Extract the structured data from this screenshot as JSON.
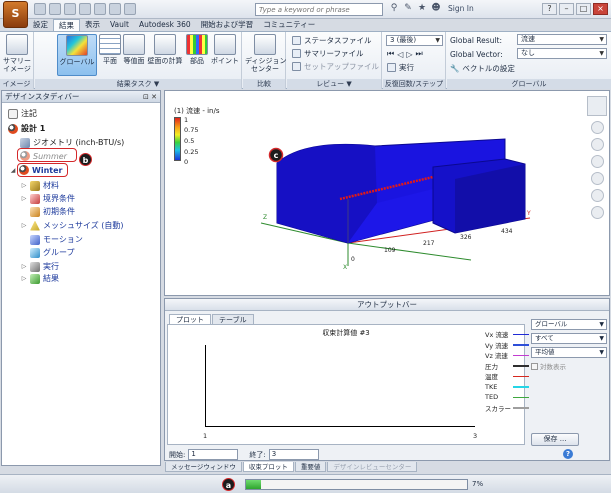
{
  "titlebar": {
    "search_placeholder": "Type a keyword or phrase",
    "sign_in": "Sign In",
    "app_letter": "S"
  },
  "ribbon_tabs": [
    "設定",
    "結果",
    "表示",
    "Vault",
    "Autodesk 360",
    "開始および学習",
    "コミュニティー"
  ],
  "ribbon": {
    "image_panel": {
      "title": "イメージ",
      "summary_image": "サマリー\nイメージ"
    },
    "results_task_panel": {
      "title": "結果タスク ▼",
      "buttons": [
        "グローバル",
        "平面",
        "等值面",
        "壁面の計算",
        "部品",
        "ポイント"
      ]
    },
    "compare_panel": {
      "title": "比較",
      "button": "ディシジョン\nセンター"
    },
    "review_panel": {
      "title": "レビュー ▼",
      "status_file": "ステータスファイル",
      "summary_file": "サマリーファイル",
      "setup_file": "セットアップファイル"
    },
    "iteration_panel": {
      "title": "反復回数/ステップ",
      "combo": "3 (最後)",
      "run": "実行"
    },
    "global_panel": {
      "title": "グローバル",
      "global_result_label": "Global Result:",
      "global_result_value": "流速",
      "global_vector_label": "Global Vector:",
      "global_vector_value": "なし",
      "vector_settings": "ベクトルの設定"
    }
  },
  "design_study_bar": {
    "title": "デザインスタディバー",
    "items": {
      "notes": "注記",
      "design": "設計 1",
      "geometry": "ジオメトリ (inch-BTU/s)",
      "summer": "Summer",
      "winter": "Winter",
      "materials": "材料",
      "boundary": "境界条件",
      "initial": "初期条件",
      "mesh": "メッシュサイズ (自動)",
      "motion": "モーション",
      "groups": "グループ",
      "run": "実行",
      "results": "結果"
    },
    "callouts": {
      "a": "a",
      "b": "b",
      "c": "c"
    }
  },
  "viewport": {
    "legend_title": "(1) 流速 - in/s",
    "legend_values": [
      "1",
      "0.75",
      "0.5",
      "0.25",
      "0"
    ],
    "axis_ticks": [
      "0",
      "109",
      "217",
      "326",
      "434"
    ],
    "axis_letters": [
      "Z",
      "X",
      "Y"
    ]
  },
  "output_bar": {
    "title": "アウトプットバー",
    "tabs": [
      "プロット",
      "テーブル"
    ],
    "plot_title": "収束計算値 #3",
    "x_ticks": [
      "1",
      "3"
    ],
    "legend": [
      {
        "name": "Vx 流速",
        "color": "#1f2bd6"
      },
      {
        "name": "Vy 流速",
        "color": "#2d4fd8"
      },
      {
        "name": "Vz 流速",
        "color": "#c23cd1"
      },
      {
        "name": "圧力",
        "color": "#2f2f2f"
      },
      {
        "name": "温度",
        "color": "#d6281f"
      },
      {
        "name": "TKE",
        "color": "#25d5e6"
      },
      {
        "name": "TED",
        "color": "#3ea83e"
      },
      {
        "name": "スカラー",
        "color": "#9e9e9e"
      }
    ],
    "combo1": "グローバル",
    "combo2": "すべて",
    "combo3": "平均値",
    "log_display": "対数表示",
    "save": "保存 ...",
    "start_label": "開始:",
    "start_value": "1",
    "end_label": "終了:",
    "end_value": "3"
  },
  "bottom_tabs": [
    "メッセージウィンドウ",
    "収束プロット",
    "重要値",
    "デザインレビューセンター"
  ],
  "status": {
    "progress_pct": 7,
    "progress_text": "7%"
  },
  "colors": {
    "accent": "#2d6fd6",
    "highlight": "#d4282a",
    "model_blue": "#1a14e0",
    "model_red": "#e01a1a"
  }
}
